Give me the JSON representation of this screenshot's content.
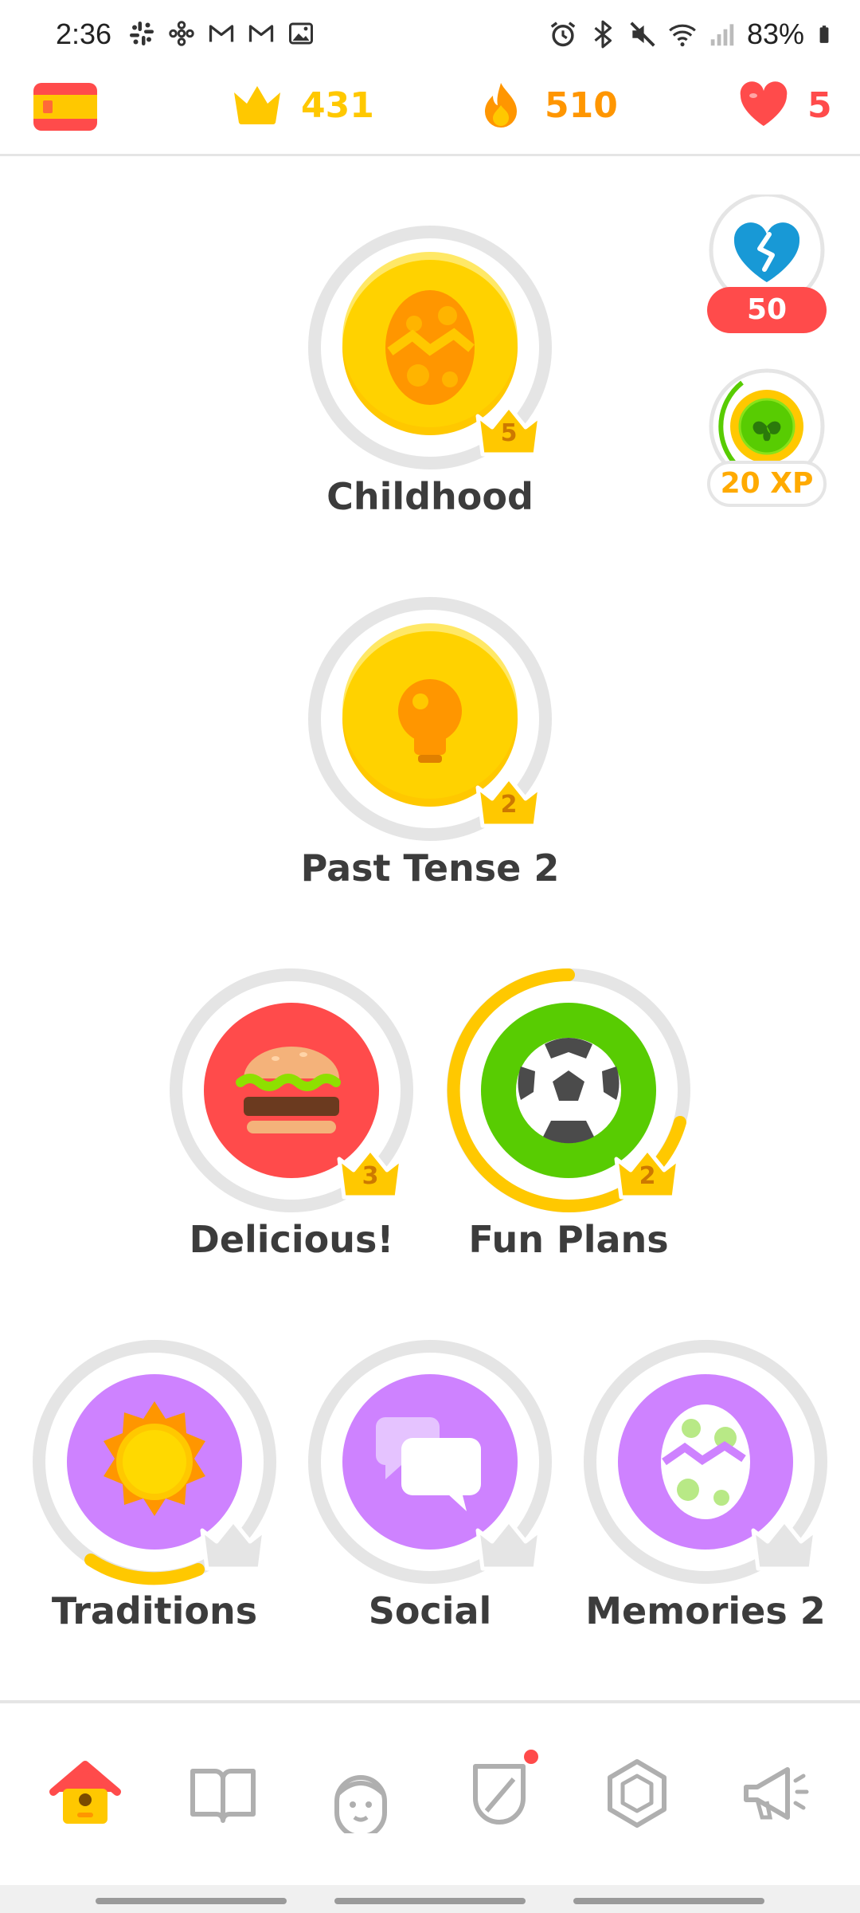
{
  "status_bar": {
    "time": "2:36",
    "left_icons": [
      "slack-icon",
      "pinwheel-icon",
      "gmail-icon",
      "gmail-icon",
      "photo-icon"
    ],
    "right_icons": [
      "alarm-icon",
      "bluetooth-icon",
      "mute-icon",
      "wifi-icon",
      "signal-icon"
    ],
    "battery": "83%"
  },
  "header": {
    "language_flag": "spain-flag",
    "crowns": "431",
    "streak": "510",
    "hearts": "5"
  },
  "side": {
    "broken_heart_count": "50",
    "xp_boost": "20 XP"
  },
  "skills": [
    {
      "name": "Childhood",
      "crowns": "5",
      "color": "#ffc800",
      "icon": "egg-icon"
    },
    {
      "name": "Past Tense 2",
      "crowns": "2",
      "color": "#ffc800",
      "icon": "lightbulb-icon"
    },
    {
      "name": "Delicious!",
      "crowns": "3",
      "color": "#ff4b4b",
      "icon": "burger-icon"
    },
    {
      "name": "Fun Plans",
      "crowns": "2",
      "color": "#58cc02",
      "icon": "soccer-ball-icon"
    },
    {
      "name": "Traditions",
      "crowns": "",
      "color": "#ce82ff",
      "icon": "sun-icon"
    },
    {
      "name": "Social",
      "crowns": "",
      "color": "#ce82ff",
      "icon": "chat-bubbles-icon"
    },
    {
      "name": "Memories 2",
      "crowns": "",
      "color": "#ce82ff",
      "icon": "spotted-egg-icon"
    }
  ],
  "nav": [
    "home-icon",
    "book-icon",
    "character-icon",
    "shield-icon",
    "hexagon-icon",
    "megaphone-icon"
  ],
  "colors": {
    "gold": "#ffc800",
    "orange": "#ff9600",
    "red": "#ff4b4b",
    "green": "#58cc02",
    "purple": "#ce82ff",
    "blue": "#1cb0f6"
  }
}
